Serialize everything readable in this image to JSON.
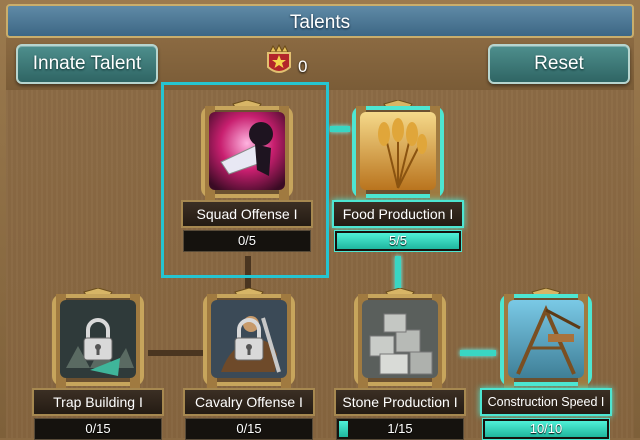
{
  "header": {
    "title": "Talents"
  },
  "toolbar": {
    "innate_label": "Innate Talent",
    "reset_label": "Reset",
    "points": "0"
  },
  "talents": [
    {
      "name": "Squad Offense I",
      "progress": "0/5",
      "fill": 0,
      "locked": false,
      "selected": true,
      "active": false
    },
    {
      "name": "Food Production I",
      "progress": "5/5",
      "fill": 1,
      "locked": false,
      "selected": false,
      "active": true
    },
    {
      "name": "Trap Building I",
      "progress": "0/15",
      "fill": 0,
      "locked": true,
      "selected": false,
      "active": false
    },
    {
      "name": "Cavalry Offense I",
      "progress": "0/15",
      "fill": 0,
      "locked": true,
      "selected": false,
      "active": false
    },
    {
      "name": "Stone Production I",
      "progress": "1/15",
      "fill": 0.07,
      "locked": false,
      "selected": false,
      "active": false
    },
    {
      "name": "Construction Speed I",
      "progress": "10/10",
      "fill": 1,
      "locked": false,
      "selected": false,
      "active": true
    }
  ],
  "colors": {
    "teal_accent": "#39d6c3",
    "button": "#3f7e7c",
    "title_bar": "#4f7b99",
    "panel": "#8a6a43"
  }
}
